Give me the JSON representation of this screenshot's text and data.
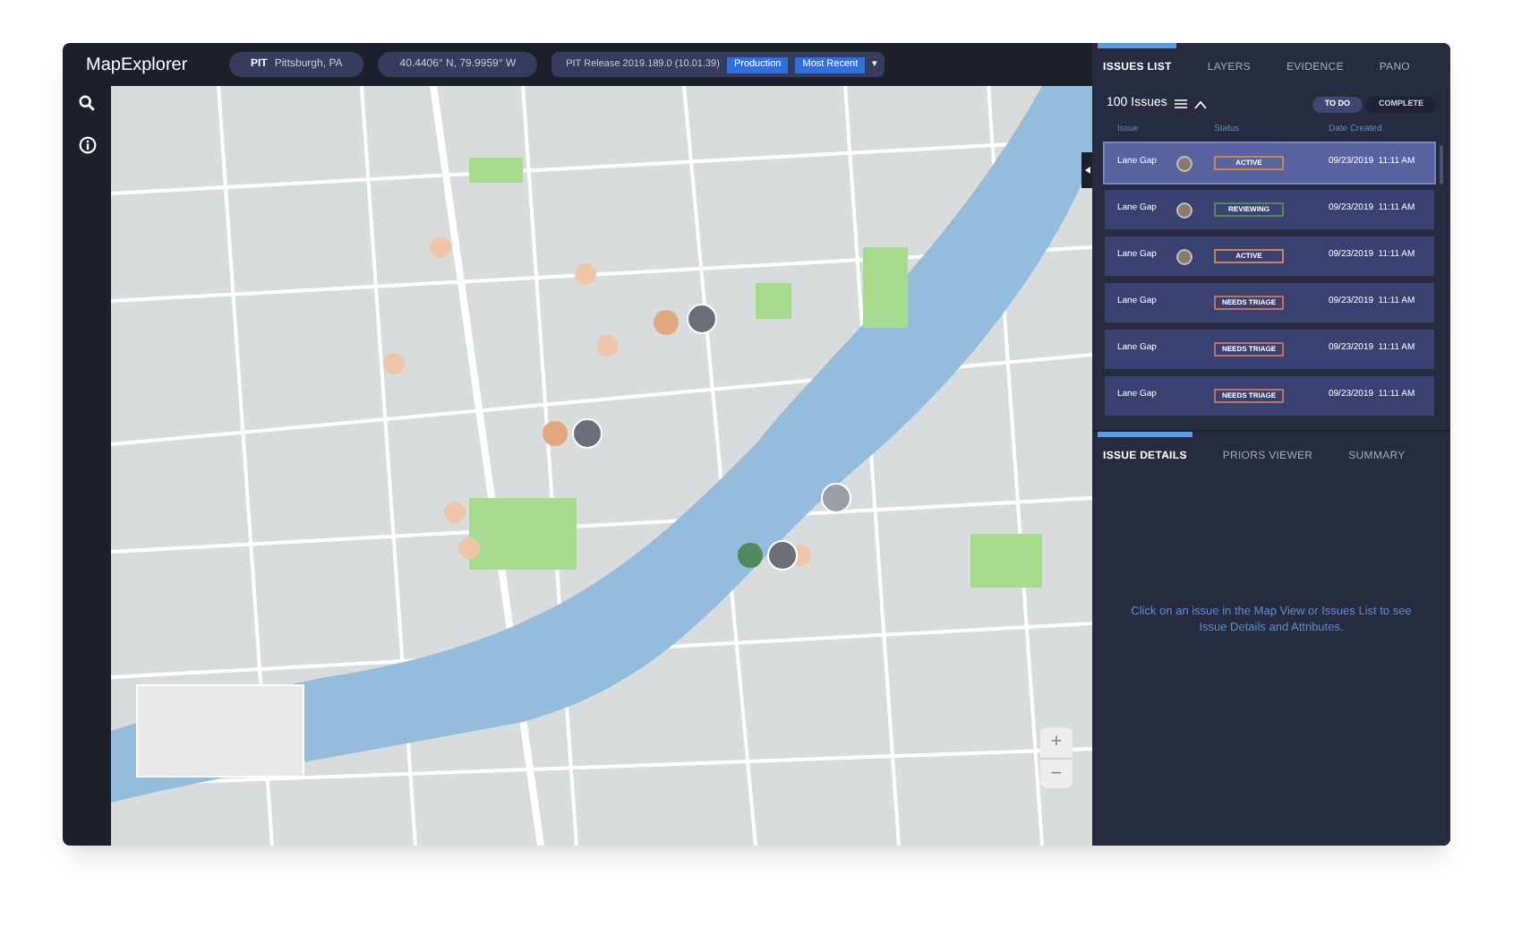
{
  "app": {
    "title": "MapExplorer"
  },
  "header": {
    "city_code": "PIT",
    "city": "Pittsburgh, PA",
    "coordinates": "40.4406° N, 79.9959° W",
    "release": "PIT Release 2019.189.0 (10.01.39)",
    "badges": [
      "Production",
      "Most Recent"
    ],
    "caret": "▾"
  },
  "map": {
    "zoom_buttons": [
      "+",
      "−"
    ]
  },
  "issues_panel": {
    "tabs": [
      {
        "label": "ISSUES LIST",
        "selected": true
      },
      {
        "label": "LAYERS",
        "selected": false
      },
      {
        "label": "EVIDENCE",
        "selected": false
      },
      {
        "label": "PANO",
        "selected": false
      }
    ],
    "count": "100 Issues",
    "filters": [
      {
        "label": "TO DO",
        "selected": true
      },
      {
        "label": "COMPLETE",
        "selected": false
      }
    ],
    "columns": [
      "Issue",
      "Status",
      "Date Created"
    ],
    "rows": [
      {
        "issue": "Lane Gap",
        "avatar": true,
        "status": "ACTIVE",
        "color": "#c8855a",
        "date": "09/23/2019  11:11 AM",
        "selected": true
      },
      {
        "issue": "Lane Gap",
        "avatar": true,
        "status": "REVIEWING",
        "color": "#4e8a5c",
        "date": "09/23/2019  11:11 AM",
        "selected": false
      },
      {
        "issue": "Lane Gap",
        "avatar": true,
        "status": "ACTIVE",
        "color": "#c8855a",
        "date": "09/23/2019  11:11 AM",
        "selected": false
      },
      {
        "issue": "Lane Gap",
        "avatar": false,
        "status": "NEEDS TRIAGE",
        "color": "#c0705e",
        "date": "09/23/2019  11:11 AM",
        "selected": false
      },
      {
        "issue": "Lane Gap",
        "avatar": false,
        "status": "NEEDS TRIAGE",
        "color": "#c0705e",
        "date": "09/23/2019  11:11 AM",
        "selected": false
      },
      {
        "issue": "Lane Gap",
        "avatar": false,
        "status": "NEEDS TRIAGE",
        "color": "#c0705e",
        "date": "09/23/2019  11:11 AM",
        "selected": false
      }
    ]
  },
  "details_panel": {
    "tabs": [
      {
        "label": "ISSUE DETAILS",
        "selected": true
      },
      {
        "label": "PRIORS VIEWER",
        "selected": false
      },
      {
        "label": "SUMMARY",
        "selected": false
      }
    ],
    "message": "Click on an issue in the Map View or Issues List to see Issue Details and Attributes."
  }
}
